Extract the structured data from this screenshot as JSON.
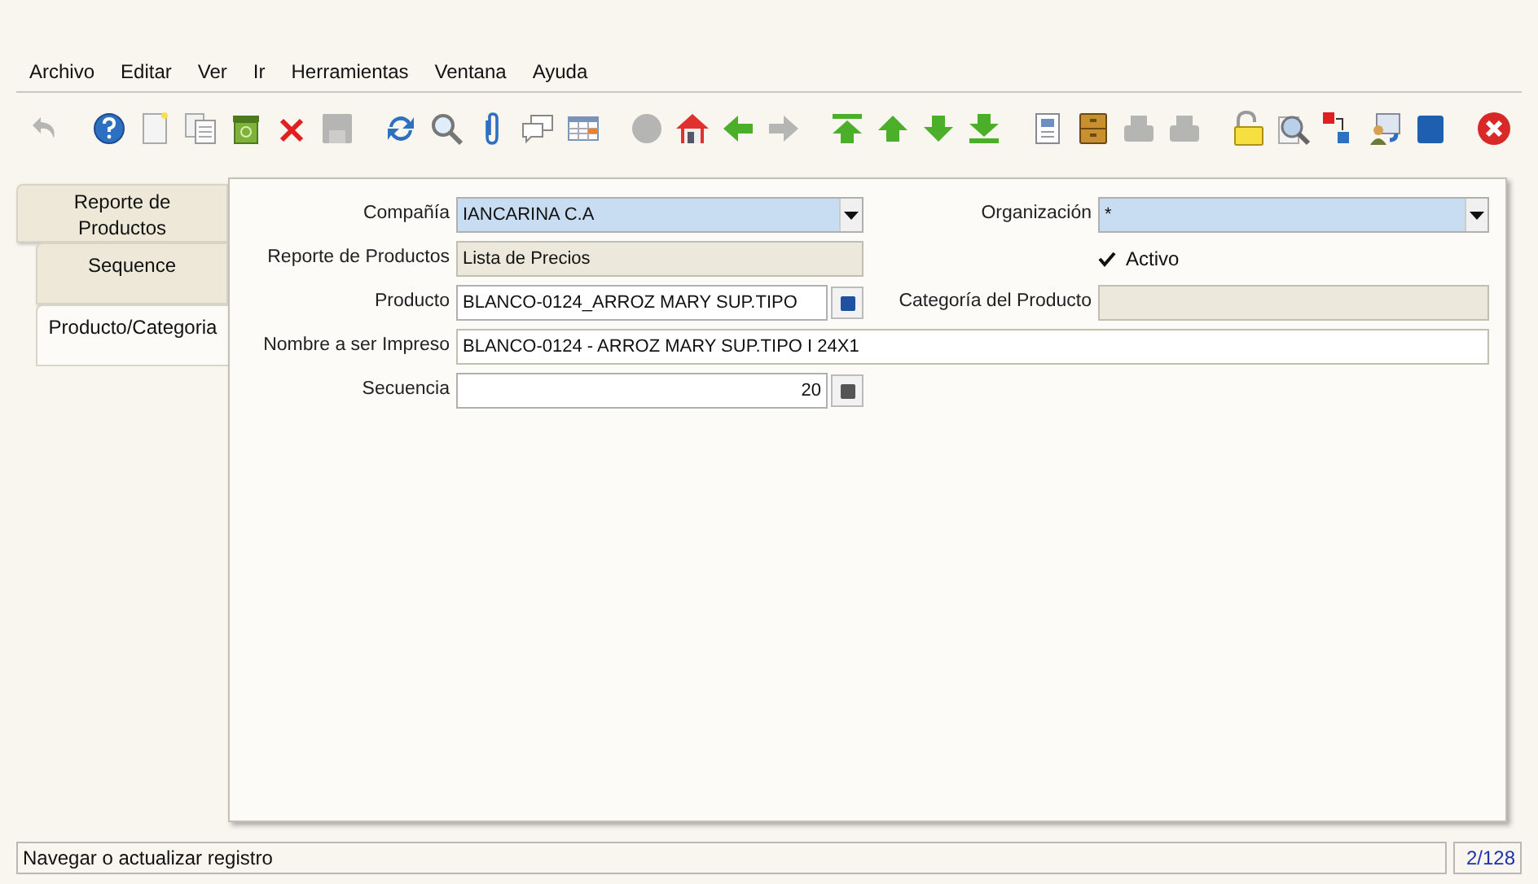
{
  "menu": [
    {
      "label": "Archivo"
    },
    {
      "label": "Editar"
    },
    {
      "label": "Ver"
    },
    {
      "label": "Ir"
    },
    {
      "label": "Herramientas"
    },
    {
      "label": "Ventana"
    },
    {
      "label": "Ayuda"
    }
  ],
  "toolbar": [
    [
      {
        "kind": "undo",
        "disabled": true
      }
    ],
    [
      {
        "kind": "help",
        "disabled": false
      },
      {
        "kind": "new",
        "disabled": false
      },
      {
        "kind": "copy",
        "disabled": false
      },
      {
        "kind": "recycle",
        "disabled": false
      },
      {
        "kind": "delete",
        "disabled": false
      },
      {
        "kind": "save",
        "disabled": true
      }
    ],
    [
      {
        "kind": "refresh",
        "disabled": false
      },
      {
        "kind": "find",
        "disabled": false
      },
      {
        "kind": "attach",
        "disabled": false
      },
      {
        "kind": "chat",
        "disabled": false
      },
      {
        "kind": "grid",
        "disabled": false
      }
    ],
    [
      {
        "kind": "history",
        "disabled": true
      },
      {
        "kind": "home",
        "disabled": false
      },
      {
        "kind": "back",
        "disabled": false
      },
      {
        "kind": "forward",
        "disabled": true
      }
    ],
    [
      {
        "kind": "first",
        "disabled": false
      },
      {
        "kind": "up",
        "disabled": false
      },
      {
        "kind": "down",
        "disabled": false
      },
      {
        "kind": "last",
        "disabled": false
      }
    ],
    [
      {
        "kind": "report",
        "disabled": false
      },
      {
        "kind": "archive",
        "disabled": false
      },
      {
        "kind": "printer",
        "disabled": true
      },
      {
        "kind": "printer",
        "disabled": true
      }
    ],
    [
      {
        "kind": "lock",
        "disabled": false
      },
      {
        "kind": "zoom",
        "disabled": false
      },
      {
        "kind": "workflow",
        "disabled": false
      },
      {
        "kind": "request",
        "disabled": false
      },
      {
        "kind": "product",
        "disabled": false
      }
    ],
    [
      {
        "kind": "close",
        "disabled": false
      }
    ]
  ],
  "tabs": [
    {
      "label": "Reporte de Productos",
      "selected": false
    },
    {
      "label": "Sequence",
      "selected": false
    },
    {
      "label": "Producto/Categoria",
      "selected": true
    }
  ],
  "form": [
    [
      {
        "kind": "combo",
        "label": "Compañía",
        "value": "IANCARINA C.A",
        "readonly": false
      },
      {
        "kind": "combo",
        "label": "Organización",
        "value": "*",
        "readonly": false
      }
    ],
    [
      {
        "kind": "text",
        "label": "Reporte de Productos",
        "value": "Lista de Precios",
        "readonly": true
      },
      {
        "kind": "checkbox",
        "label": "Activo",
        "checked": true
      }
    ],
    [
      {
        "kind": "search",
        "label": "Producto",
        "value": "BLANCO-0124_ARROZ MARY SUP.TIPO",
        "readonly": false
      },
      {
        "kind": "text",
        "label": "Categoría del Producto",
        "readonly": true
      }
    ],
    [
      {
        "kind": "wide",
        "label": "Nombre a ser Impreso",
        "value": "BLANCO-0124 - ARROZ MARY SUP.TIPO I 24X1",
        "readonly": false
      }
    ],
    [
      {
        "kind": "number",
        "label": "Secuencia",
        "value": "20",
        "readonly": false
      }
    ]
  ],
  "status": {
    "message": "Navegar o actualizar registro",
    "record": "2/128"
  }
}
